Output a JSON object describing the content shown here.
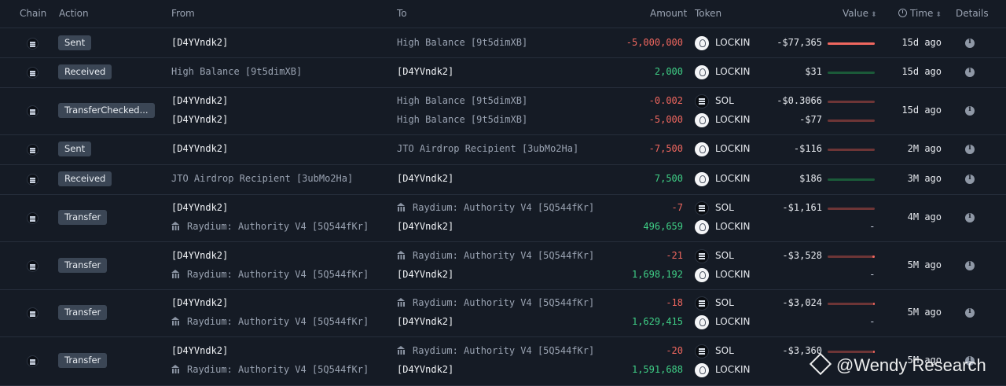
{
  "header": {
    "chain": "Chain",
    "action": "Action",
    "from": "From",
    "to": "To",
    "amount": "Amount",
    "token": "Token",
    "value": "Value",
    "time": "Time",
    "details": "Details",
    "sort_glyph": "⬍"
  },
  "rows": [
    {
      "action": "Sent",
      "lines": [
        {
          "from": "[D4YVndk2]",
          "from_kind": "own",
          "to": "High Balance [9t5dimXB]",
          "to_kind": "ext",
          "amount": "-5,000,000",
          "sign": "neg",
          "token": "LOCKIN",
          "value": "-$77,365",
          "bar": 1.0
        }
      ],
      "time": "15d ago"
    },
    {
      "action": "Received",
      "lines": [
        {
          "from": "High Balance [9t5dimXB]",
          "from_kind": "ext",
          "to": "[D4YVndk2]",
          "to_kind": "own",
          "amount": "2,000",
          "sign": "pos",
          "token": "LOCKIN",
          "value": "$31",
          "bar": 0.0
        }
      ],
      "time": "15d ago"
    },
    {
      "action": "TransferChecked...",
      "lines": [
        {
          "from": "[D4YVndk2]",
          "from_kind": "own",
          "to": "High Balance [9t5dimXB]",
          "to_kind": "ext",
          "amount": "-0.002",
          "sign": "neg",
          "token": "SOL",
          "value": "-$0.3066",
          "bar": 0.0
        },
        {
          "from": "[D4YVndk2]",
          "from_kind": "own",
          "to": "High Balance [9t5dimXB]",
          "to_kind": "ext",
          "amount": "-5,000",
          "sign": "neg",
          "token": "LOCKIN",
          "value": "-$77",
          "bar": 0.0
        }
      ],
      "time": "15d ago"
    },
    {
      "action": "Sent",
      "lines": [
        {
          "from": "[D4YVndk2]",
          "from_kind": "own",
          "to": "JTO Airdrop Recipient [3ubMo2Ha]",
          "to_kind": "ext",
          "amount": "-7,500",
          "sign": "neg",
          "token": "LOCKIN",
          "value": "-$116",
          "bar": 0.0
        }
      ],
      "time": "2M ago"
    },
    {
      "action": "Received",
      "lines": [
        {
          "from": "JTO Airdrop Recipient [3ubMo2Ha]",
          "from_kind": "ext",
          "to": "[D4YVndk2]",
          "to_kind": "own",
          "amount": "7,500",
          "sign": "pos",
          "token": "LOCKIN",
          "value": "$186",
          "bar": 0.0
        }
      ],
      "time": "3M ago"
    },
    {
      "action": "Transfer",
      "lines": [
        {
          "from": "[D4YVndk2]",
          "from_kind": "own",
          "to": "Raydium: Authority V4 [5Q544fKr]",
          "to_kind": "bank",
          "amount": "-7",
          "sign": "neg",
          "token": "SOL",
          "value": "-$1,161",
          "bar": 0.0
        },
        {
          "from": "Raydium: Authority V4 [5Q544fKr]",
          "from_kind": "bank",
          "to": "[D4YVndk2]",
          "to_kind": "own",
          "amount": "496,659",
          "sign": "pos",
          "token": "LOCKIN",
          "value": "",
          "dash": "-"
        }
      ],
      "time": "4M ago"
    },
    {
      "action": "Transfer",
      "lines": [
        {
          "from": "[D4YVndk2]",
          "from_kind": "own",
          "to": "Raydium: Authority V4 [5Q544fKr]",
          "to_kind": "bank",
          "amount": "-21",
          "sign": "neg",
          "token": "SOL",
          "value": "-$3,528",
          "bar": 0.05
        },
        {
          "from": "Raydium: Authority V4 [5Q544fKr]",
          "from_kind": "bank",
          "to": "[D4YVndk2]",
          "to_kind": "own",
          "amount": "1,698,192",
          "sign": "pos",
          "token": "LOCKIN",
          "value": "",
          "dash": "-"
        }
      ],
      "time": "5M ago"
    },
    {
      "action": "Transfer",
      "lines": [
        {
          "from": "[D4YVndk2]",
          "from_kind": "own",
          "to": "Raydium: Authority V4 [5Q544fKr]",
          "to_kind": "bank",
          "amount": "-18",
          "sign": "neg",
          "token": "SOL",
          "value": "-$3,024",
          "bar": 0.04
        },
        {
          "from": "Raydium: Authority V4 [5Q544fKr]",
          "from_kind": "bank",
          "to": "[D4YVndk2]",
          "to_kind": "own",
          "amount": "1,629,415",
          "sign": "pos",
          "token": "LOCKIN",
          "value": "",
          "dash": "-"
        }
      ],
      "time": "5M ago"
    },
    {
      "action": "Transfer",
      "lines": [
        {
          "from": "[D4YVndk2]",
          "from_kind": "own",
          "to": "Raydium: Authority V4 [5Q544fKr]",
          "to_kind": "bank",
          "amount": "-20",
          "sign": "neg",
          "token": "SOL",
          "value": "-$3,360",
          "bar": 0.04
        },
        {
          "from": "Raydium: Authority V4 [5Q544fKr]",
          "from_kind": "bank",
          "to": "[D4YVndk2]",
          "to_kind": "own",
          "amount": "1,591,688",
          "sign": "pos",
          "token": "LOCKIN",
          "value": ""
        }
      ],
      "time": "5M ago"
    }
  ],
  "watermark": "@Wendy Research",
  "colors": {
    "negative": "#f0675f",
    "positive": "#3fcf86",
    "badge": "#3b4655",
    "background": "#151b25"
  }
}
